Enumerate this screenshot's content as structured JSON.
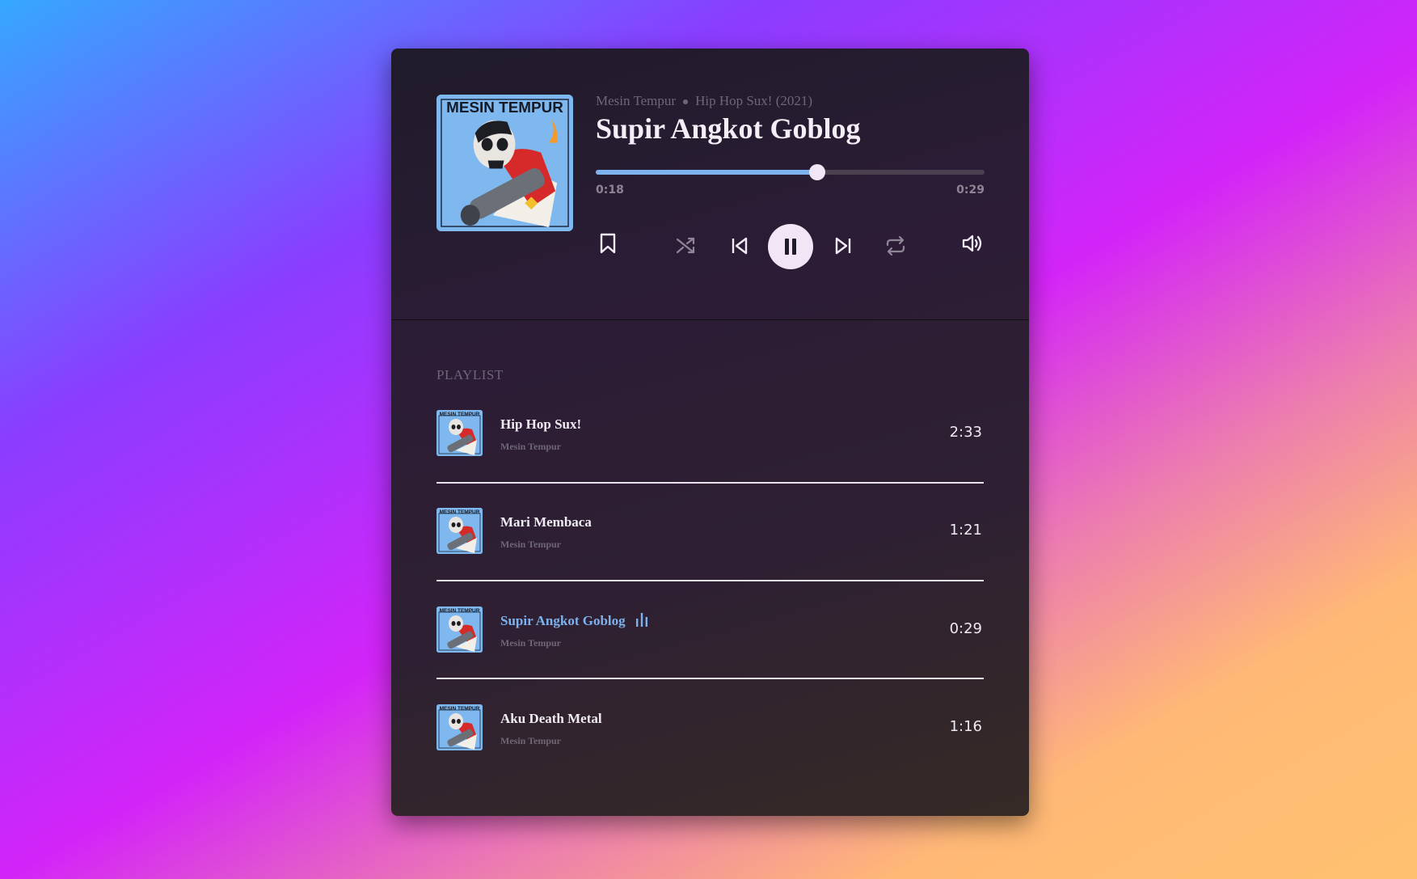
{
  "now_playing": {
    "artist": "Mesin Tempur",
    "album": "Hip Hop Sux! (2021)",
    "title": "Supir Angkot Goblog",
    "current_time": "0:18",
    "total_time": "0:29",
    "progress_fraction": 0.57,
    "cover_text": "MESIN TEMPUR"
  },
  "controls": {
    "bookmark_icon": "bookmark-icon",
    "shuffle_icon": "shuffle-icon",
    "previous_icon": "skip-previous-icon",
    "play_state_icon": "pause-icon",
    "next_icon": "skip-next-icon",
    "repeat_icon": "repeat-icon",
    "volume_icon": "volume-icon"
  },
  "playlist": {
    "label": "PLAYLIST",
    "tracks": [
      {
        "title": "Hip Hop Sux!",
        "artist": "Mesin Tempur",
        "duration": "2:33",
        "active": false
      },
      {
        "title": "Mari Membaca",
        "artist": "Mesin Tempur",
        "duration": "1:21",
        "active": false
      },
      {
        "title": "Supir Angkot Goblog",
        "artist": "Mesin Tempur",
        "duration": "0:29",
        "active": true
      },
      {
        "title": "Aku Death Metal",
        "artist": "Mesin Tempur",
        "duration": "1:16",
        "active": false
      }
    ]
  },
  "colors": {
    "accent": "#7db2ee",
    "text_primary": "#f4eef6",
    "text_muted": "#6f6676",
    "panel_bg": "#2a1e30"
  }
}
